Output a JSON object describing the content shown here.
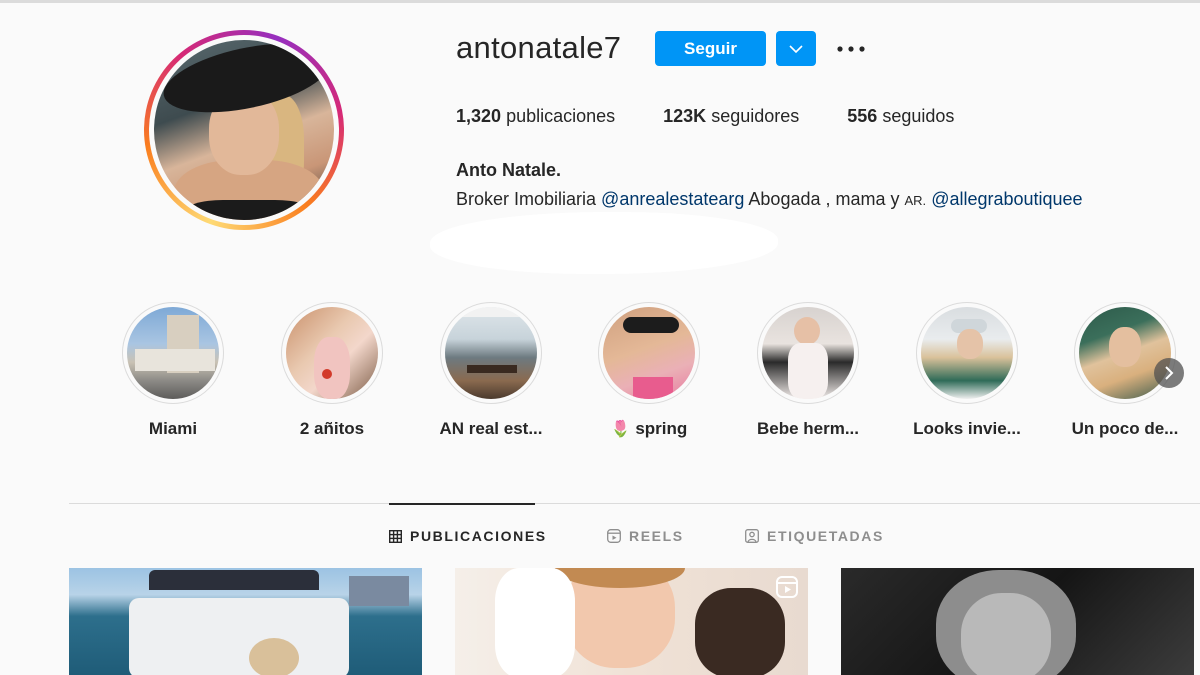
{
  "profile": {
    "username": "antonatale7",
    "follow_label": "Seguir",
    "stats": {
      "posts_count": "1,320",
      "posts_label": "publicaciones",
      "followers_count": "123K",
      "followers_label": "seguidores",
      "following_count": "556",
      "following_label": "seguidos"
    },
    "full_name": "Anto Natale.",
    "bio": {
      "prefix": "Broker Imobiliaria ",
      "mention1": "@anrealestatearg",
      "middle": " Abogada , mama y ",
      "small": "AR.",
      "spacer": " ",
      "mention2": "@allegraboutiquee"
    }
  },
  "highlights": [
    {
      "label": "Miami"
    },
    {
      "label": "2 añitos"
    },
    {
      "label": "AN real est..."
    },
    {
      "emoji": "🌷",
      "label": "spring"
    },
    {
      "label": "Bebe herm..."
    },
    {
      "label": "Looks invie..."
    },
    {
      "label": "Un poco de..."
    }
  ],
  "tabs": [
    {
      "label": "PUBLICACIONES",
      "icon": "grid-icon",
      "active": true
    },
    {
      "label": "REELS",
      "icon": "reels-icon",
      "active": false
    },
    {
      "label": "ETIQUETADAS",
      "icon": "tagged-icon",
      "active": false
    }
  ],
  "colors": {
    "accent": "#0095f6",
    "mention": "#00376b",
    "background": "#fafafa"
  }
}
